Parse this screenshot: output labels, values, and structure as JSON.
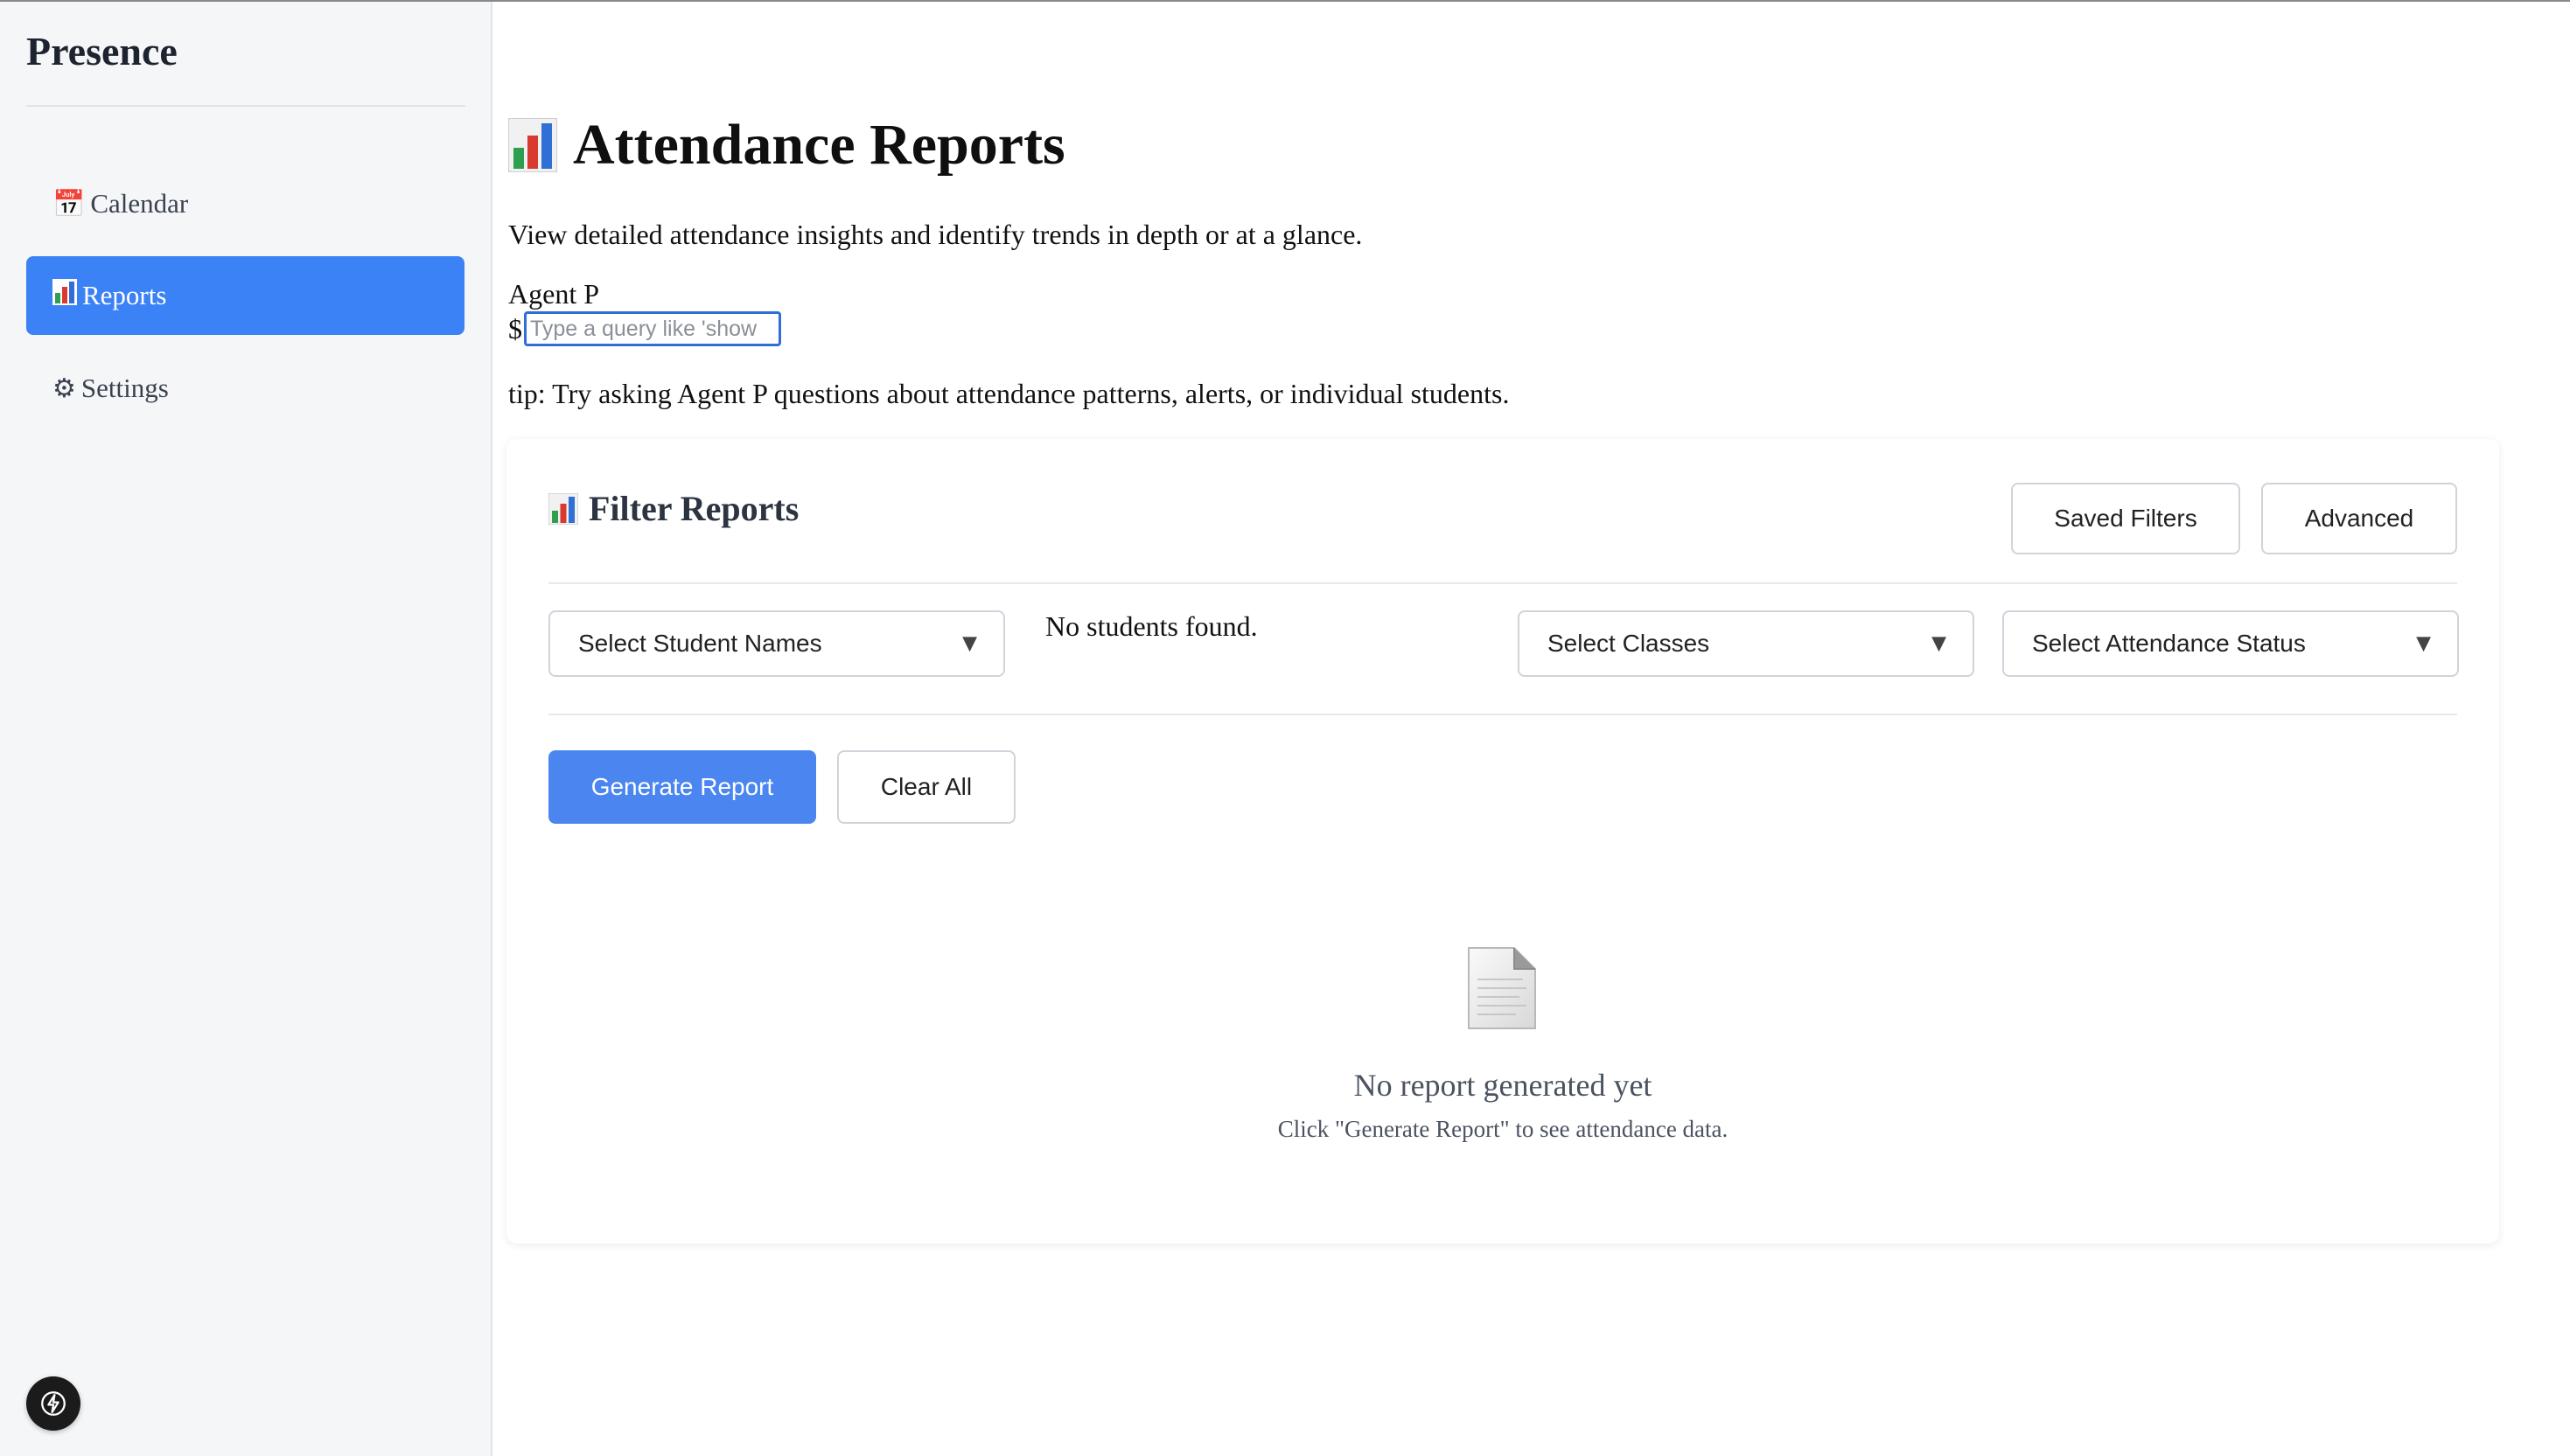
{
  "app": {
    "name": "Presence"
  },
  "sidebar": {
    "items": [
      {
        "label": "Calendar",
        "icon": "calendar-icon",
        "glyph": "📅",
        "active": false
      },
      {
        "label": "Reports",
        "icon": "bar-chart-icon",
        "glyph": "📊",
        "active": true
      },
      {
        "label": "Settings",
        "icon": "gear-icon",
        "glyph": "⚙",
        "active": false
      }
    ]
  },
  "header": {
    "title": "Attendance Reports",
    "subtitle": "View detailed attendance insights and identify trends in depth or at a glance."
  },
  "agent": {
    "label": "Agent P",
    "prompt_symbol": "$",
    "input_value": "",
    "input_placeholder": "Type a query like 'show",
    "tip": "tip: Try asking Agent P questions about attendance patterns, alerts, or individual students."
  },
  "filters": {
    "title": "Filter Reports",
    "saved_filters_label": "Saved Filters",
    "advanced_label": "Advanced",
    "student_select": "Select Student Names",
    "no_students": "No students found.",
    "class_select": "Select Classes",
    "status_select": "Select Attendance Status",
    "generate_label": "Generate Report",
    "clear_label": "Clear All"
  },
  "empty_state": {
    "title": "No report generated yet",
    "message": "Click \"Generate Report\" to see attendance data."
  },
  "colors": {
    "accent": "#3b82f6",
    "primary_button": "#4a85f0",
    "sidebar_bg": "#f5f6f8",
    "input_border": "#2f6fd6"
  }
}
